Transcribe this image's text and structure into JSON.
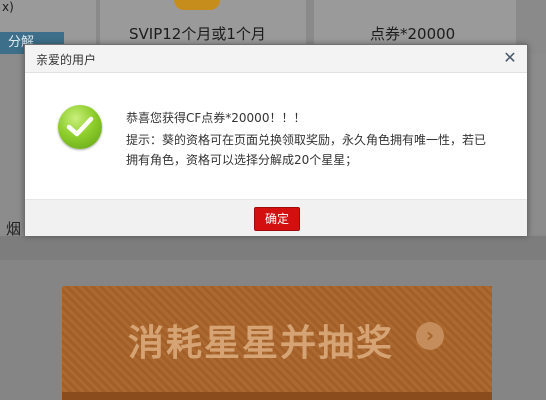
{
  "background": {
    "top_left_char": "x)",
    "split_button_label": "分解",
    "card_vip_label": "SVIP12个月或1个月",
    "card_coupon_label": "点券*20000",
    "left_partial_char": "烟",
    "banner_text": "消耗星星并抽奖",
    "banner_arrow": "›"
  },
  "modal": {
    "title": "亲爱的用户",
    "close_symbol": "✕",
    "line1": "恭喜您获得CF点券*20000！！！",
    "line2": "提示：葵的资格可在页面兑换领取奖励，永久角色拥有唯一性，若已",
    "line3": "拥有角色，资格可以选择分解成20个星星；",
    "confirm_label": "确定"
  },
  "colors": {
    "confirm_button": "#d40f0f",
    "success_icon": "#7fc125",
    "overlay": "#7b7b7b",
    "banner": "#a9642a"
  },
  "icons": {
    "success": "checkmark-circle-icon",
    "close": "close-icon",
    "banner_arrow": "chevron-right-icon"
  }
}
